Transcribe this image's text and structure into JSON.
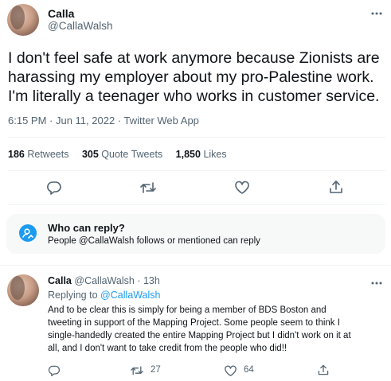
{
  "main_tweet": {
    "display_name": "Calla",
    "handle": "@CallaWalsh",
    "text_lines": [
      "I don't feel safe at work anymore because Zionists are",
      "harassing my employer about my pro-Palestine work.",
      "I'm literally a teenager who works in customer service."
    ],
    "timestamp": "6:15 PM · Jun 11, 2022 · Twitter Web App",
    "stats": [
      {
        "count": "186",
        "label": "Retweets"
      },
      {
        "count": "305",
        "label": "Quote Tweets"
      },
      {
        "count": "1,850",
        "label": "Likes"
      }
    ]
  },
  "reply_notice": {
    "title": "Who can reply?",
    "text": "People @CallaWalsh follows or mentioned can reply"
  },
  "reply_tweet": {
    "display_name": "Calla",
    "handle": "@CallaWalsh",
    "age": "13h",
    "replying_prefix": "Replying to",
    "replying_handle": "@CallaWalsh",
    "text_lines": [
      "And to be clear this is simply for being a member of BDS Boston and",
      "tweeting in support of the Mapping Project. Some people seem to think I",
      "single-handedly created the entire Mapping Project but I didn't work on it at",
      "all, and I don't want to take credit from the people who did!!"
    ],
    "retweet_count": "27",
    "like_count": "64"
  },
  "colors": {
    "link": "#1d9bf0",
    "notice_bg": "#f7f9f9",
    "muted": "#536471"
  },
  "icons": [
    "more-icon",
    "reply-icon",
    "retweet-icon",
    "like-icon",
    "share-icon",
    "reply-restriction-icon"
  ]
}
